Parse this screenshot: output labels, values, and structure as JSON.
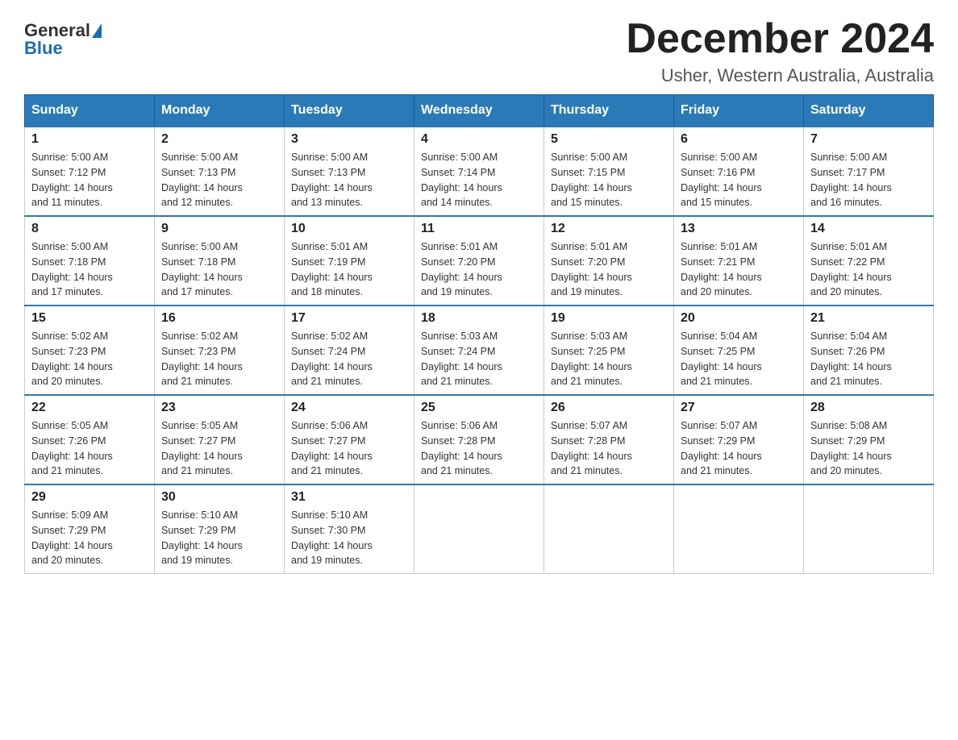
{
  "header": {
    "logo_general": "General",
    "logo_blue": "Blue",
    "month_title": "December 2024",
    "location": "Usher, Western Australia, Australia"
  },
  "days_of_week": [
    "Sunday",
    "Monday",
    "Tuesday",
    "Wednesday",
    "Thursday",
    "Friday",
    "Saturday"
  ],
  "weeks": [
    [
      {
        "day": "1",
        "sunrise": "5:00 AM",
        "sunset": "7:12 PM",
        "daylight": "14 hours and 11 minutes."
      },
      {
        "day": "2",
        "sunrise": "5:00 AM",
        "sunset": "7:13 PM",
        "daylight": "14 hours and 12 minutes."
      },
      {
        "day": "3",
        "sunrise": "5:00 AM",
        "sunset": "7:13 PM",
        "daylight": "14 hours and 13 minutes."
      },
      {
        "day": "4",
        "sunrise": "5:00 AM",
        "sunset": "7:14 PM",
        "daylight": "14 hours and 14 minutes."
      },
      {
        "day": "5",
        "sunrise": "5:00 AM",
        "sunset": "7:15 PM",
        "daylight": "14 hours and 15 minutes."
      },
      {
        "day": "6",
        "sunrise": "5:00 AM",
        "sunset": "7:16 PM",
        "daylight": "14 hours and 15 minutes."
      },
      {
        "day": "7",
        "sunrise": "5:00 AM",
        "sunset": "7:17 PM",
        "daylight": "14 hours and 16 minutes."
      }
    ],
    [
      {
        "day": "8",
        "sunrise": "5:00 AM",
        "sunset": "7:18 PM",
        "daylight": "14 hours and 17 minutes."
      },
      {
        "day": "9",
        "sunrise": "5:00 AM",
        "sunset": "7:18 PM",
        "daylight": "14 hours and 17 minutes."
      },
      {
        "day": "10",
        "sunrise": "5:01 AM",
        "sunset": "7:19 PM",
        "daylight": "14 hours and 18 minutes."
      },
      {
        "day": "11",
        "sunrise": "5:01 AM",
        "sunset": "7:20 PM",
        "daylight": "14 hours and 19 minutes."
      },
      {
        "day": "12",
        "sunrise": "5:01 AM",
        "sunset": "7:20 PM",
        "daylight": "14 hours and 19 minutes."
      },
      {
        "day": "13",
        "sunrise": "5:01 AM",
        "sunset": "7:21 PM",
        "daylight": "14 hours and 20 minutes."
      },
      {
        "day": "14",
        "sunrise": "5:01 AM",
        "sunset": "7:22 PM",
        "daylight": "14 hours and 20 minutes."
      }
    ],
    [
      {
        "day": "15",
        "sunrise": "5:02 AM",
        "sunset": "7:23 PM",
        "daylight": "14 hours and 20 minutes."
      },
      {
        "day": "16",
        "sunrise": "5:02 AM",
        "sunset": "7:23 PM",
        "daylight": "14 hours and 21 minutes."
      },
      {
        "day": "17",
        "sunrise": "5:02 AM",
        "sunset": "7:24 PM",
        "daylight": "14 hours and 21 minutes."
      },
      {
        "day": "18",
        "sunrise": "5:03 AM",
        "sunset": "7:24 PM",
        "daylight": "14 hours and 21 minutes."
      },
      {
        "day": "19",
        "sunrise": "5:03 AM",
        "sunset": "7:25 PM",
        "daylight": "14 hours and 21 minutes."
      },
      {
        "day": "20",
        "sunrise": "5:04 AM",
        "sunset": "7:25 PM",
        "daylight": "14 hours and 21 minutes."
      },
      {
        "day": "21",
        "sunrise": "5:04 AM",
        "sunset": "7:26 PM",
        "daylight": "14 hours and 21 minutes."
      }
    ],
    [
      {
        "day": "22",
        "sunrise": "5:05 AM",
        "sunset": "7:26 PM",
        "daylight": "14 hours and 21 minutes."
      },
      {
        "day": "23",
        "sunrise": "5:05 AM",
        "sunset": "7:27 PM",
        "daylight": "14 hours and 21 minutes."
      },
      {
        "day": "24",
        "sunrise": "5:06 AM",
        "sunset": "7:27 PM",
        "daylight": "14 hours and 21 minutes."
      },
      {
        "day": "25",
        "sunrise": "5:06 AM",
        "sunset": "7:28 PM",
        "daylight": "14 hours and 21 minutes."
      },
      {
        "day": "26",
        "sunrise": "5:07 AM",
        "sunset": "7:28 PM",
        "daylight": "14 hours and 21 minutes."
      },
      {
        "day": "27",
        "sunrise": "5:07 AM",
        "sunset": "7:29 PM",
        "daylight": "14 hours and 21 minutes."
      },
      {
        "day": "28",
        "sunrise": "5:08 AM",
        "sunset": "7:29 PM",
        "daylight": "14 hours and 20 minutes."
      }
    ],
    [
      {
        "day": "29",
        "sunrise": "5:09 AM",
        "sunset": "7:29 PM",
        "daylight": "14 hours and 20 minutes."
      },
      {
        "day": "30",
        "sunrise": "5:10 AM",
        "sunset": "7:29 PM",
        "daylight": "14 hours and 19 minutes."
      },
      {
        "day": "31",
        "sunrise": "5:10 AM",
        "sunset": "7:30 PM",
        "daylight": "14 hours and 19 minutes."
      },
      null,
      null,
      null,
      null
    ]
  ],
  "labels": {
    "sunrise": "Sunrise:",
    "sunset": "Sunset:",
    "daylight": "Daylight:"
  }
}
